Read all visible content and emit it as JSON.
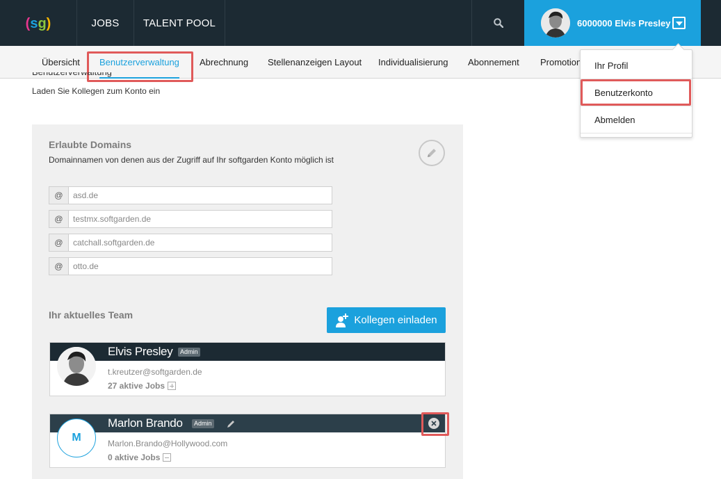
{
  "topnav": {
    "logo_text": "(sg)",
    "items": [
      {
        "label": "JOBS"
      },
      {
        "label": "TALENT POOL"
      }
    ],
    "user_label": "6000000 Elvis Presley"
  },
  "subnav": {
    "tabs": [
      {
        "label": "Übersicht"
      },
      {
        "label": "Benutzerverwaltung"
      },
      {
        "label": "Abrechnung"
      },
      {
        "label": "Stellenanzeigen Layout"
      },
      {
        "label": "Individualisierung"
      },
      {
        "label": "Abonnement"
      },
      {
        "label": "Promotion"
      }
    ]
  },
  "page": {
    "title": "Benutzerverwaltung",
    "description": "Laden Sie Kollegen zum Konto ein"
  },
  "domains": {
    "title": "Erlaubte Domains",
    "description": "Domainnamen von denen aus der Zugriff auf Ihr softgarden Konto möglich ist",
    "prefix": "@",
    "entries": [
      "asd.de",
      "testmx.softgarden.de",
      "catchall.softgarden.de",
      "otto.de"
    ]
  },
  "team": {
    "title": "Ihr aktuelles Team",
    "invite_label": "Kollegen einladen",
    "members": [
      {
        "name": "Elvis Presley",
        "badge": "Admin",
        "email": "t.kreutzer@softgarden.de",
        "jobs": "27 aktive Jobs"
      },
      {
        "name": "Marlon Brando",
        "badge": "Admin",
        "initial": "M",
        "email": "Marlon.Brando@Hollywood.com",
        "jobs": "0 aktive Jobs"
      }
    ]
  },
  "dropdown": {
    "items": [
      {
        "label": "Ihr Profil"
      },
      {
        "label": "Benutzerkonto"
      },
      {
        "label": "Abmelden"
      }
    ]
  },
  "colors": {
    "nav_bg": "#1c2a33",
    "accent": "#1ba1dd",
    "highlight": "#e05a5a"
  }
}
